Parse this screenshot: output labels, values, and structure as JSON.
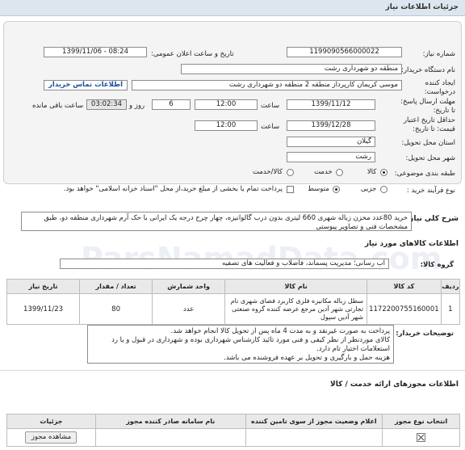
{
  "header": {
    "title": "جزئیات اطلاعات نیاز"
  },
  "fields": {
    "need_number_label": "شماره نیاز:",
    "need_number": "1199090566000022",
    "announce_label": "تاریخ و ساعت اعلان عمومی:",
    "announce_value": "1399/11/06 - 08:24",
    "buyer_org_label": "نام دستگاه خریدار:",
    "buyer_org": "منطقه دو شهرداری رشت",
    "creator_label": "ایجاد کننده درخواست:",
    "creator": "موسی کریمان کارپرداز منطقه 2 منطقه دو شهرداری رشت",
    "contact_link": "اطلاعات تماس خریدار",
    "deadline_label": "مهلت ارسال پاسخ: تا تاریخ:",
    "deadline_date": "1399/11/12",
    "time_label": "ساعت",
    "deadline_time": "12:00",
    "days_value": "6",
    "days_label": "روز و",
    "remaining_time": "03:02:34",
    "remaining_label": "ساعت باقی مانده",
    "validity_label": "حداقل تاریخ اعتبار قیمت: تا تاریخ:",
    "validity_date": "1399/12/28",
    "validity_time": "12:00",
    "province_label": "استان محل تحویل:",
    "province": "گیلان",
    "city_label": "شهر محل تحویل:",
    "city": "رشت",
    "category_label": "طبقه بندی موضوعی:",
    "cat_goods": "کالا",
    "cat_service": "خدمت",
    "cat_goods_service": "کالا/خدمت",
    "process_label": "نوع فرآیند خرید :",
    "proc_minor": "جزیی",
    "proc_medium": "متوسط",
    "treasury_note": "پرداخت تمام یا بخشی از مبلغ خرید،از محل \"اسناد خزانه اسلامی\" خواهد بود."
  },
  "summary": {
    "label": "شرح کلی نیاز:",
    "text": "خرید 80عدد مخزن زباله شهری 660 لیتری بدون درب گالوانیزه، چهار چرخ درجه یک ایرانی با حک آرم شهرداری منطقه دو، طبق مشخصات فنی و تصاویر پیوستی"
  },
  "goods_section": {
    "title": "اطلاعات کالاهای مورد نیاز",
    "group_label": "گروه کالا:",
    "group_value": "آب رسانی؛ مدیریت پسماند، فاضلاب و فعالیت های تصفیه",
    "watermark": "ParsNamadData.com",
    "columns": [
      "ردیف",
      "کد کالا",
      "نام کالا",
      "واحد شمارش",
      "تعداد / مقدار",
      "تاریخ نیاز"
    ],
    "rows": [
      {
        "row": "1",
        "code": "1172200755160001",
        "name": "سطل زباله مکانیزه فلزی کاربرد فضای شهری نام تجارتی شهر آدین مرجع عرضه کننده گروه صنعتی شهر آدین سپول",
        "unit": "عدد",
        "qty": "80",
        "date": "1399/11/23"
      }
    ]
  },
  "buyer_notes": {
    "label": "توضیحات خریدار:",
    "lines": [
      "پرداخت به صورت غیرنقد و به مدت 4 ماه پس از تحویل کالا انجام خواهد شد.",
      "کالای موردنظر از نظر کیفی و فنی مورد تائید کارشناس شهرداری بوده و شهرداری در قبول و یا رد",
      "استعلامات اختیار تام دارد.",
      "هزینه حمل و بارگیری و تحویل بر عهده فروشنده می باشد."
    ]
  },
  "permits": {
    "title": "اطلاعات مجوزهای ارائه خدمت / کالا",
    "columns": [
      "انتخاب نوع مجوز",
      "اعلام وضعیت مجوز از سوی تامین کننده",
      "نام سامانه صادر کننده مجوز",
      "جزئیات"
    ],
    "view_button": "مشاهده مجوز"
  }
}
